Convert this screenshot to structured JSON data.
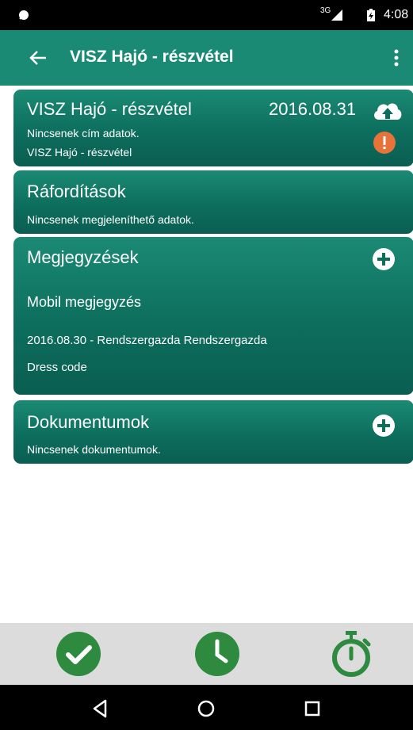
{
  "status_bar": {
    "network": "3G",
    "time": "4:08"
  },
  "app_bar": {
    "title": "VISZ Hajó - részvétel"
  },
  "event_card": {
    "title": "VISZ Hajó - részvétel",
    "date": "2016.08.31",
    "address_text": "Nincsenek cím adatok.",
    "subtitle": "VISZ Hajó - részvétel"
  },
  "expenses_card": {
    "title": "Ráfordítások",
    "empty_text": "Nincsenek megjeleníthető adatok."
  },
  "notes_card": {
    "title": "Megjegyzések",
    "note_title": "Mobil megjegyzés",
    "note_meta": "2016.08.30 - Rendszergazda Rendszergazda",
    "note_body": "Dress code"
  },
  "documents_card": {
    "title": "Dokumentumok",
    "empty_text": "Nincsenek dokumentumok."
  },
  "colors": {
    "app_bar": "#1a8a74",
    "card": "#0d6e5d",
    "warning": "#e8733a",
    "action_green": "#2d8a3e",
    "bottom_bar": "#dcdcdc"
  },
  "icons": {
    "upload": "cloud-upload-icon",
    "warning": "warning-icon",
    "add": "plus-circle-icon",
    "check": "check-circle-icon",
    "clock": "clock-icon",
    "timer": "stopwatch-icon"
  }
}
